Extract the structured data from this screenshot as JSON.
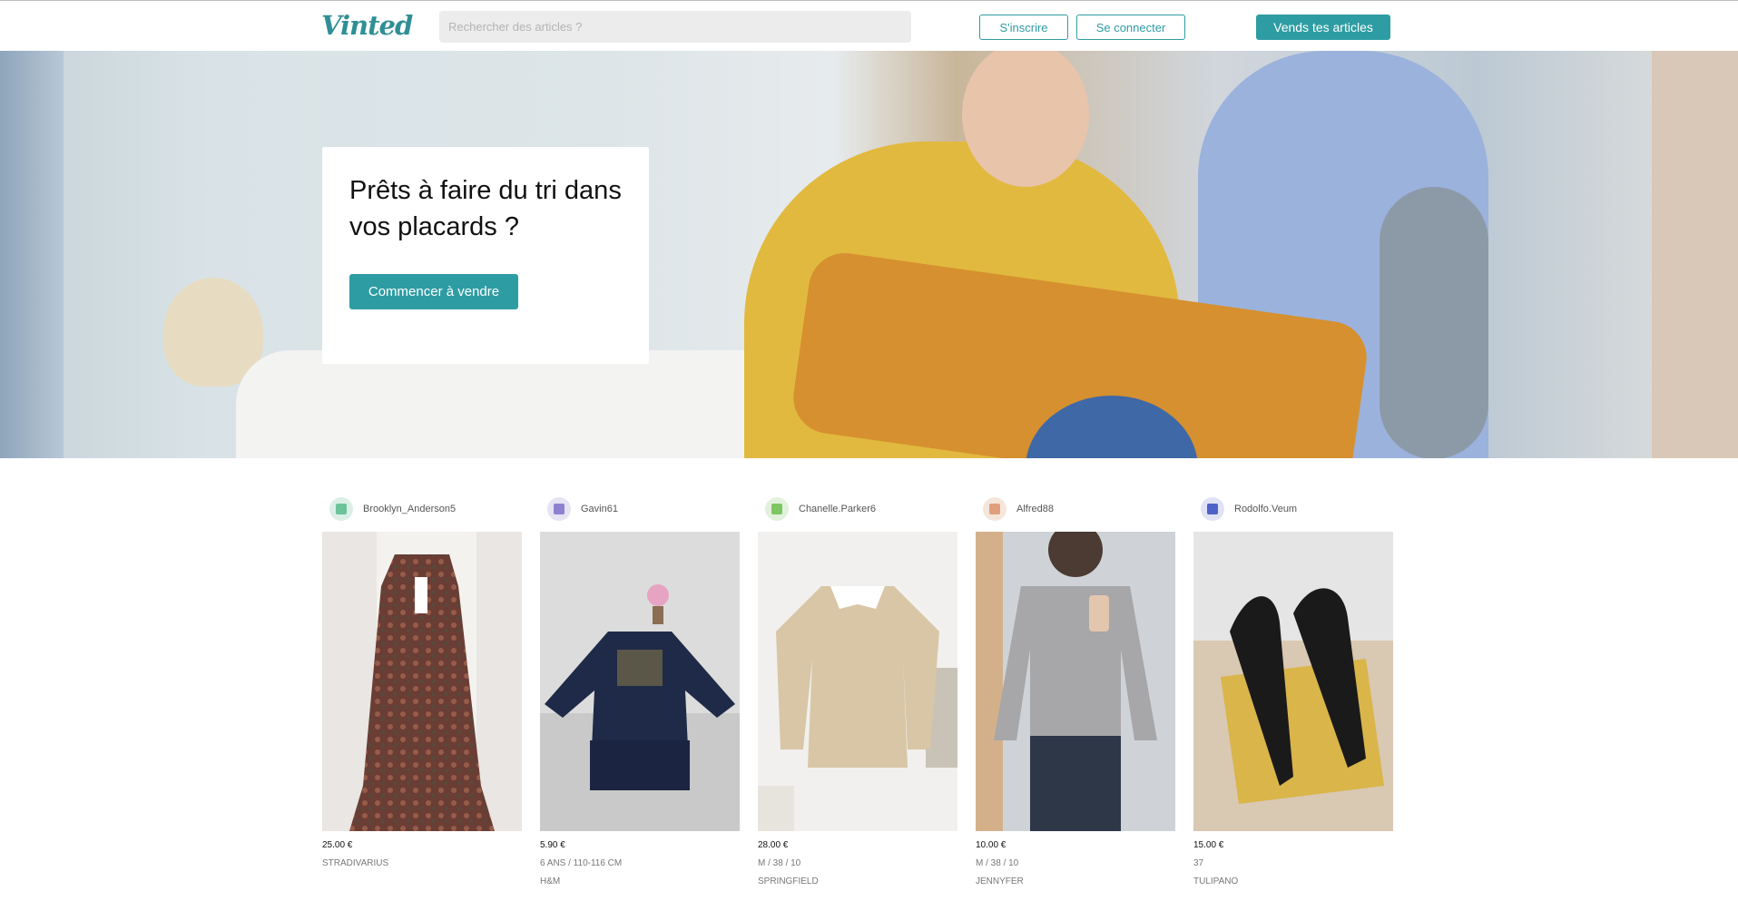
{
  "header": {
    "logo": "Vinted",
    "search_placeholder": "Rechercher des articles ?",
    "signup_label": "S'inscrire",
    "login_label": "Se connecter",
    "sell_label": "Vends tes articles"
  },
  "hero": {
    "title": "Prêts à faire du tri dans vos placards ?",
    "cta_label": "Commencer à vendre"
  },
  "items": [
    {
      "user": "Brooklyn_Anderson5",
      "price": "25.00 €",
      "line1": "STRADIVARIUS",
      "line2": ""
    },
    {
      "user": "Gavin61",
      "price": "5.90 €",
      "line1": "6 ans / 110-116 cm",
      "line2": "H&M"
    },
    {
      "user": "Chanelle.Parker6",
      "price": "28.00 €",
      "line1": "M / 38 / 10",
      "line2": "SPRINGFIELD"
    },
    {
      "user": "Alfred88",
      "price": "10.00 €",
      "line1": "M / 38 / 10",
      "line2": "JENNYFER"
    },
    {
      "user": "Rodolfo.Veum",
      "price": "15.00 €",
      "line1": "37",
      "line2": "TULIPANO"
    }
  ],
  "colors": {
    "accent": "#2e9ca3"
  }
}
